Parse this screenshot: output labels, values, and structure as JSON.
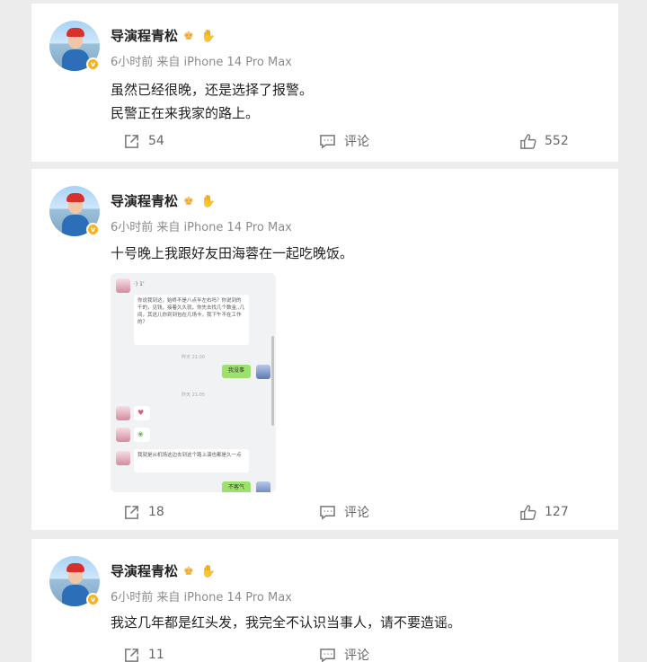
{
  "posts": [
    {
      "username": "导演程青松",
      "crown_icon": "crown-icon",
      "hand_icon": "hand-icon",
      "meta": "6小时前  来自 iPhone 14 Pro Max",
      "lines": [
        "虽然已经很晚，还是选择了报警。",
        "民警正在来我家的路上。"
      ],
      "share_count": "54",
      "comment_label": "评论",
      "like_count": "552"
    },
    {
      "username": "导演程青松",
      "meta": "6小时前  来自 iPhone 14 Pro Max",
      "lines": [
        "十号晚上我跟好友田海蓉在一起吃晚饭。"
      ],
      "chat": {
        "top_label": "·) 1'",
        "message_1": "你说我到达，始终不是八点半左右吗？你说到的千的，见钱，接着久久就，你先去找几个数金,,几间，其这儿你到到包在几场卡，我下午不在工作的？",
        "time_1": "昨天 21:00",
        "reply_1": "我没事",
        "time_2": "昨天 21:05",
        "message_4": "我就是从机场这边去到这个路上演也都是久一点",
        "reply_2": "不客气"
      },
      "share_count": "18",
      "comment_label": "评论",
      "like_count": "127"
    },
    {
      "username": "导演程青松",
      "meta": "6小时前  来自 iPhone 14 Pro Max",
      "lines": [
        "我这几年都是红头发，我完全不认识当事人，请不要造谣。"
      ],
      "share_count": "11",
      "comment_label": "评论"
    }
  ],
  "colors": {
    "page_bg": "#ececec",
    "card_bg": "#ffffff",
    "verified_badge": "#f7b21c",
    "chat_green": "#9ee06d"
  }
}
